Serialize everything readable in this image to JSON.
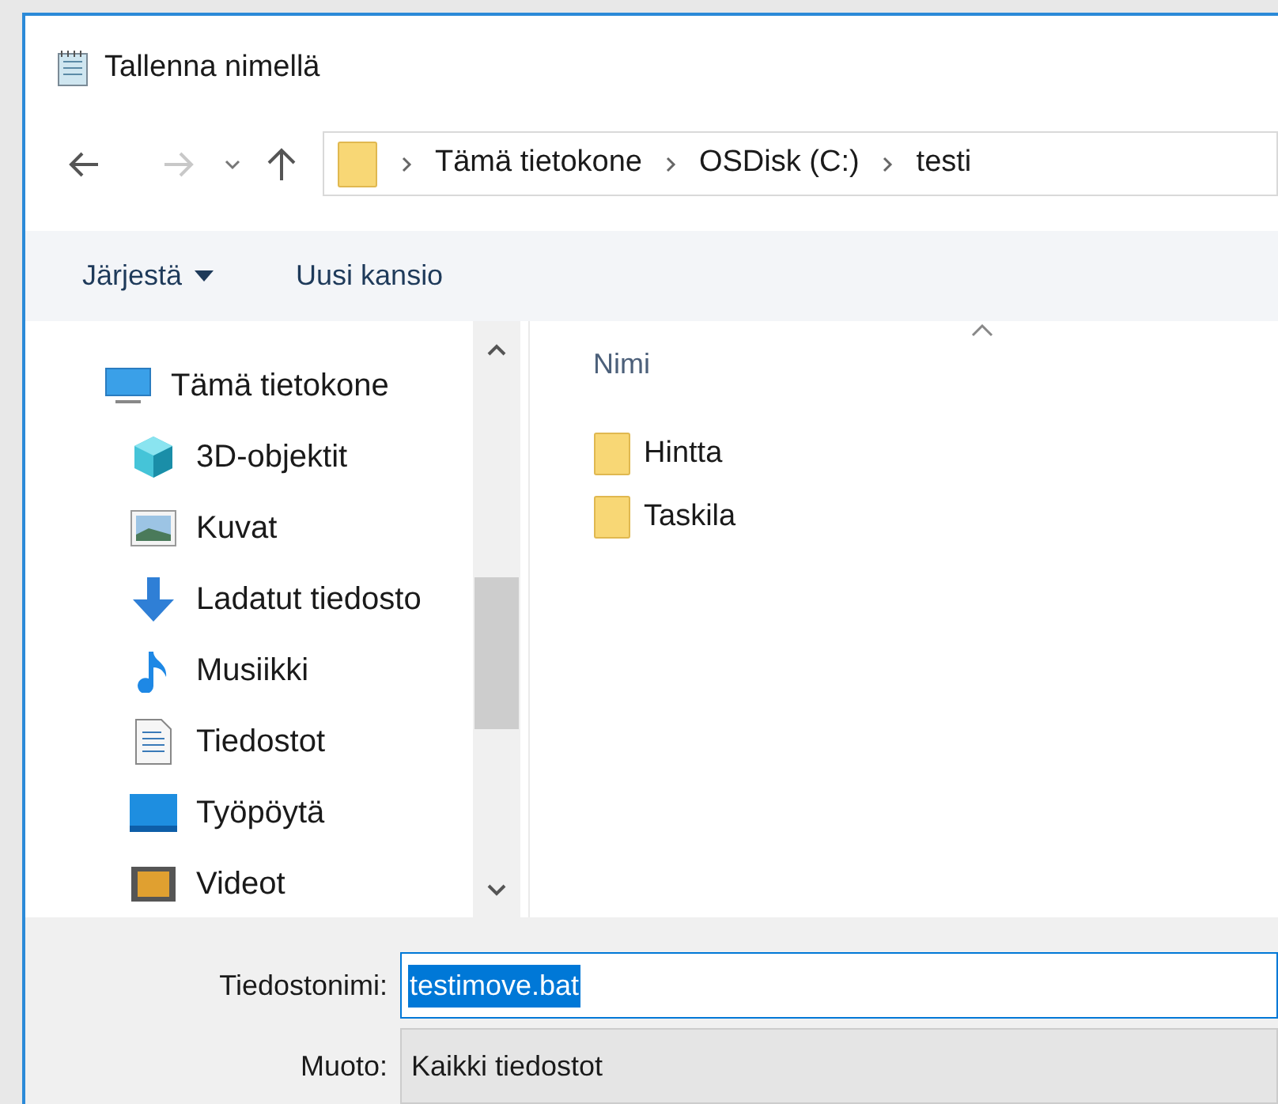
{
  "window": {
    "title": "Tallenna nimellä"
  },
  "address_bar": {
    "breadcrumbs": [
      "Tämä tietokone",
      "OSDisk (C:)",
      "testi"
    ]
  },
  "toolbar": {
    "organize": "Järjestä",
    "new_folder": "Uusi kansio"
  },
  "nav_pane": {
    "items": [
      {
        "label": "Tämä tietokone",
        "kind": "computer",
        "children": [
          {
            "label": "3D-objektit",
            "kind": "cube"
          },
          {
            "label": "Kuvat",
            "kind": "pictures"
          },
          {
            "label": "Ladatut tiedosto",
            "kind": "download"
          },
          {
            "label": "Musiikki",
            "kind": "music"
          },
          {
            "label": "Tiedostot",
            "kind": "document"
          },
          {
            "label": "Työpöytä",
            "kind": "desktop"
          },
          {
            "label": "Videot",
            "kind": "video"
          }
        ]
      }
    ]
  },
  "file_list": {
    "columns": [
      "Nimi"
    ],
    "sorted": true,
    "items": [
      {
        "name": "Hintta"
      },
      {
        "name": "Taskila"
      }
    ]
  },
  "file_name": {
    "label": "Tiedostonimi:",
    "value": "testimove.bat",
    "text_selected": true
  },
  "file_type": {
    "label": "Muoto:",
    "value": "Kaikki tiedostot"
  }
}
